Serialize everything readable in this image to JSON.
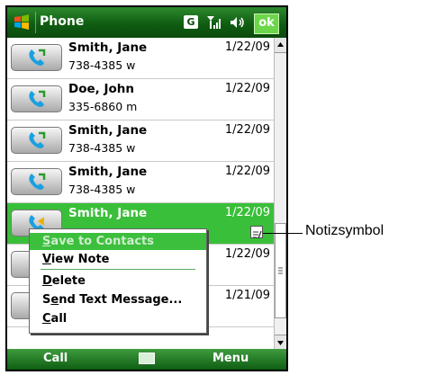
{
  "titlebar": {
    "title": "Phone",
    "network_badge": "G",
    "ok_label": "ok",
    "icons": [
      "windows-flag-icon",
      "signal-icon",
      "volume-icon"
    ]
  },
  "calls": [
    {
      "name": "Smith, Jane",
      "number": "738-4385 w",
      "date": "1/22/09",
      "type": "outgoing"
    },
    {
      "name": "Doe, John",
      "number": "335-6860 m",
      "date": "1/22/09",
      "type": "outgoing"
    },
    {
      "name": "Smith, Jane",
      "number": "738-4385 w",
      "date": "1/22/09",
      "type": "outgoing"
    },
    {
      "name": "Smith, Jane",
      "number": "738-4385 w",
      "date": "1/22/09",
      "type": "outgoing"
    },
    {
      "name": "Smith, Jane",
      "number": "",
      "date": "1/22/09",
      "type": "missed",
      "selected": true,
      "has_note": true
    },
    {
      "name": "",
      "number": "",
      "date": "1/22/09",
      "type": "outgoing"
    },
    {
      "name": "",
      "number": "",
      "date": "1/21/09",
      "type": "outgoing"
    }
  ],
  "context_menu": {
    "items": [
      "Save to Contacts",
      "View Note",
      "Delete",
      "Send Text Message...",
      "Call"
    ],
    "highlighted_index": 0
  },
  "softkeys": {
    "left": "Call",
    "right": "Menu"
  },
  "annotation": {
    "label": "Notizsymbol"
  },
  "colors": {
    "titlebar": "#0f5d12",
    "selection": "#39bf39",
    "ok": "#6cd64a"
  }
}
